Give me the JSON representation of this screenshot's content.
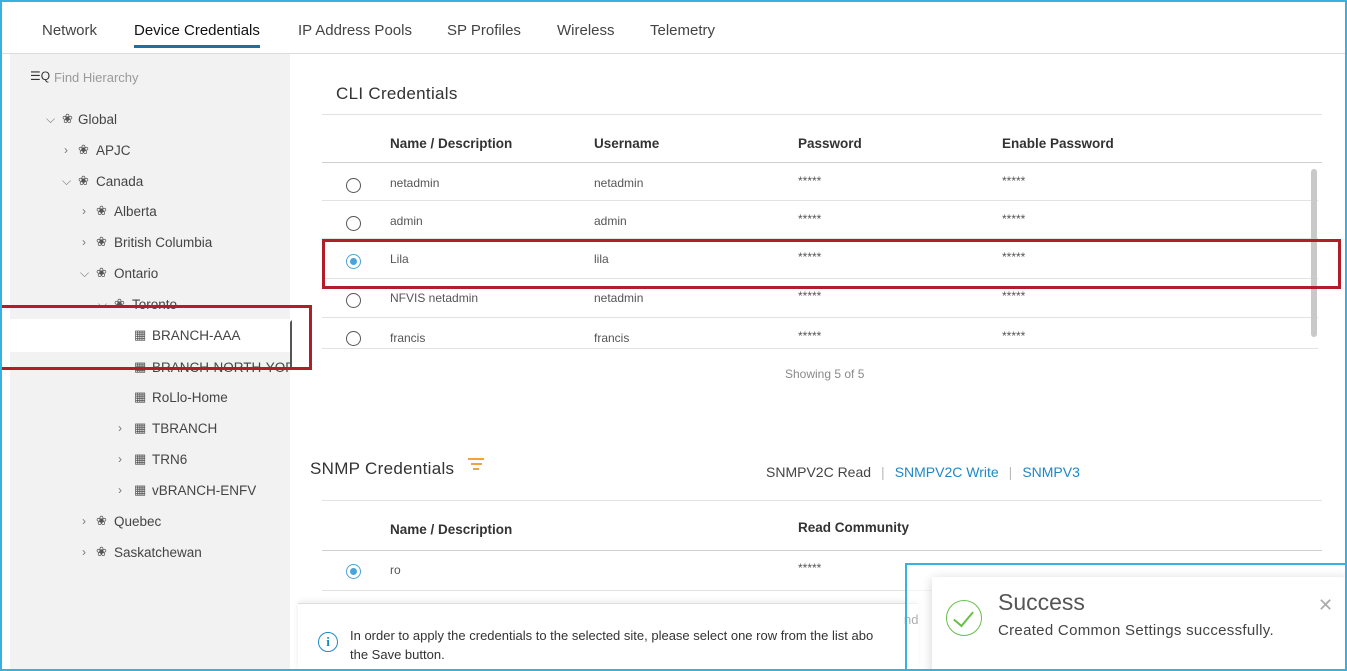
{
  "tabs": [
    {
      "label": "Network"
    },
    {
      "label": "Device Credentials"
    },
    {
      "label": "IP Address Pools"
    },
    {
      "label": "SP Profiles"
    },
    {
      "label": "Wireless"
    },
    {
      "label": "Telemetry"
    }
  ],
  "active_tab": "Device Credentials",
  "sidebar": {
    "search_icon": "filter-search-icon",
    "search_placeholder": "Find Hierarchy",
    "tree": [
      {
        "label": "Global",
        "icon": "sites-icon",
        "chevron": "down"
      },
      {
        "label": "APJC",
        "icon": "sites-icon",
        "chevron": "right"
      },
      {
        "label": "Canada",
        "icon": "sites-icon",
        "chevron": "down"
      },
      {
        "label": "Alberta",
        "icon": "sites-icon",
        "chevron": "right"
      },
      {
        "label": "British Columbia",
        "icon": "sites-icon",
        "chevron": "right"
      },
      {
        "label": "Ontario",
        "icon": "sites-icon",
        "chevron": "down"
      },
      {
        "label": "Toronto",
        "icon": "sites-icon",
        "chevron": "down"
      },
      {
        "label": "BRANCH-AAA",
        "icon": "building-icon",
        "selected": true
      },
      {
        "label": "BRANCH-NORTH-YORK",
        "icon": "building-icon"
      },
      {
        "label": "RoLlo-Home",
        "icon": "building-icon"
      },
      {
        "label": "TBRANCH",
        "icon": "building-icon",
        "chevron": "right"
      },
      {
        "label": "TRN6",
        "icon": "building-icon",
        "chevron": "right"
      },
      {
        "label": "vBRANCH-ENFV",
        "icon": "building-icon",
        "chevron": "right"
      },
      {
        "label": "Quebec",
        "icon": "sites-icon",
        "chevron": "right"
      },
      {
        "label": "Saskatchewan",
        "icon": "sites-icon",
        "chevron": "right"
      }
    ]
  },
  "cli": {
    "title": "CLI Credentials",
    "columns": [
      "Name / Description",
      "Username",
      "Password",
      "Enable Password"
    ],
    "rows": [
      {
        "name": "netadmin",
        "username": "netadmin",
        "password": "*****",
        "enable": "*****",
        "selected": false
      },
      {
        "name": "admin",
        "username": "admin",
        "password": "*****",
        "enable": "*****",
        "selected": false
      },
      {
        "name": "Lila",
        "username": "lila",
        "password": "*****",
        "enable": "*****",
        "selected": true
      },
      {
        "name": "NFVIS netadmin",
        "username": "netadmin",
        "password": "*****",
        "enable": "*****",
        "selected": false
      },
      {
        "name": "francis",
        "username": "francis",
        "password": "*****",
        "enable": "*****",
        "selected": false
      }
    ],
    "showing": "Showing 5 of 5"
  },
  "snmp": {
    "title": "SNMP Credentials",
    "tabs": [
      {
        "label": "SNMPV2C Read",
        "active": true
      },
      {
        "label": "SNMPV2C Write",
        "active": false
      },
      {
        "label": "SNMPV3",
        "active": false
      }
    ],
    "columns": [
      "Name / Description",
      "Read Community"
    ],
    "rows": [
      {
        "name": "ro",
        "read_community": "*****",
        "selected": true
      }
    ]
  },
  "info": {
    "text": "In order to apply the credentials to the selected site, please select one row from the list abo",
    "text_right": "nd",
    "text_line2": "the Save button."
  },
  "toast": {
    "title": "Success",
    "message": "Created Common Settings successfully."
  },
  "colors": {
    "accent": "#1e88c7",
    "highlight": "#b11e2a",
    "frame": "#3ab0e2",
    "success": "#6abf4b",
    "filter": "#f2a33c"
  }
}
